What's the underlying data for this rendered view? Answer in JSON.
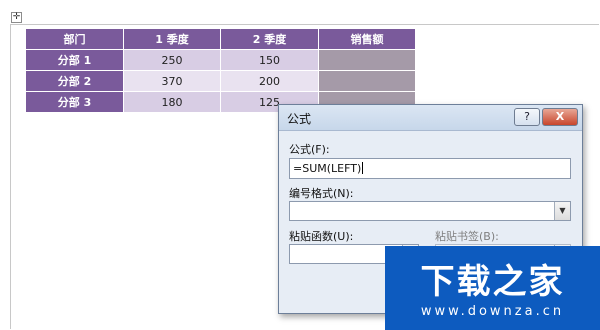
{
  "table": {
    "headers": [
      "部门",
      "1 季度",
      "2 季度",
      "销售额"
    ],
    "rows": [
      {
        "dept": "分部 1",
        "q1": "250",
        "q2": "150",
        "sales": ""
      },
      {
        "dept": "分部 2",
        "q1": "370",
        "q2": "200",
        "sales": ""
      },
      {
        "dept": "分部 3",
        "q1": "180",
        "q2": "125",
        "sales": ""
      }
    ]
  },
  "dialog": {
    "title": "公式",
    "help_label": "?",
    "close_label": "X",
    "formula_label": "公式(F):",
    "formula_value": "=SUM(LEFT)",
    "number_format_label": "编号格式(N):",
    "number_format_value": "",
    "paste_function_label": "粘贴函数(U):",
    "paste_function_value": "",
    "paste_bookmark_label": "粘贴书签(B):",
    "paste_bookmark_value": ""
  },
  "watermark": {
    "main": "下载之家",
    "sub": "www.downza.cn"
  },
  "icons": {
    "table_move_handle": "move-cross-icon",
    "dropdown": "chevron-down-icon"
  },
  "colors": {
    "table_header": "#7a5a9b",
    "table_cell_dark": "#d8cde4",
    "table_cell_light": "#e9e2f0",
    "dialog_bg": "#e7edf5",
    "watermark_bg": "#0d5bbf"
  }
}
